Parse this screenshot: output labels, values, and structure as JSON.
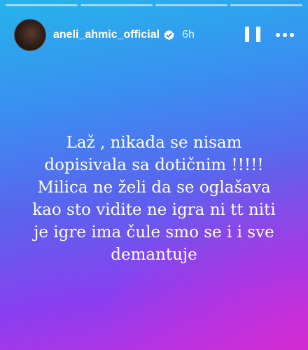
{
  "story": {
    "progress_segments": 4,
    "author": {
      "username": "aneli_ahmic_official",
      "time_ago": "6h",
      "avatar_icon": "profile-photo",
      "verified_icon": "verified-badge-icon"
    },
    "controls": {
      "pause_icon": "pause-icon",
      "more_icon": "more-options-icon"
    },
    "text_lines": [
      "Laž , nikada se nisam",
      "dopisivala sa dotičnim !!!!!",
      "Milica ne želi da se oglašava",
      "kao sto vidite ne igra ni tt niti",
      "je igre ima čule smo se i i sve",
      "demantuje"
    ],
    "colors": {
      "gradient_top": "#25b4ec",
      "gradient_middle": "#5b62ee",
      "gradient_bottom": "#c12fe0",
      "text": "#ffffff"
    }
  }
}
